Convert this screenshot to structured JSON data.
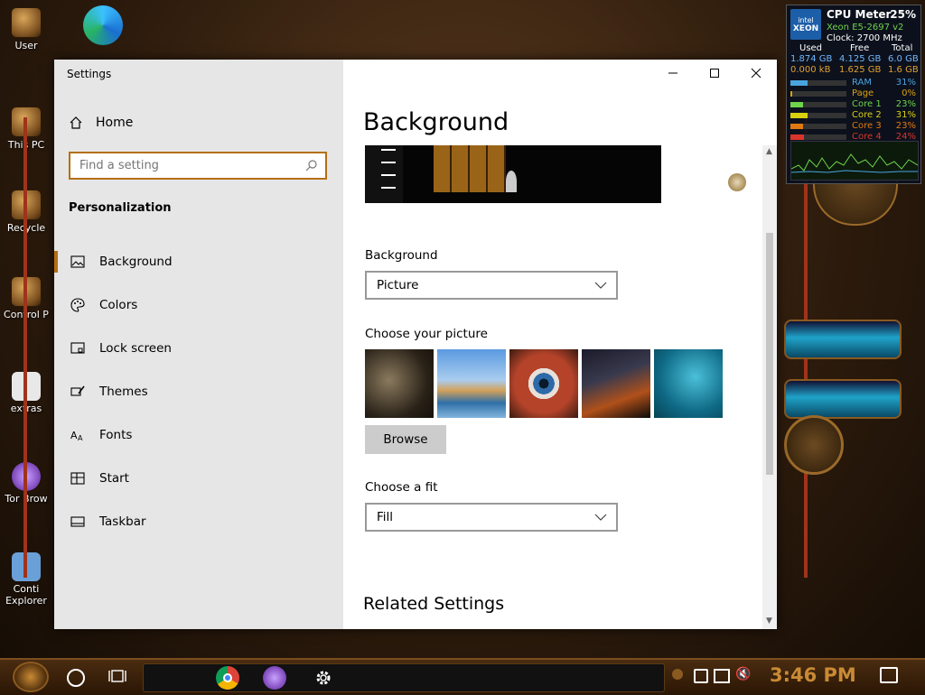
{
  "desktop": {
    "icons": [
      {
        "label": "User"
      },
      {
        "label": "This PC"
      },
      {
        "label": "Recycle"
      },
      {
        "label": "Control P"
      },
      {
        "label": "extras"
      },
      {
        "label": "Tor Brow"
      },
      {
        "label": "Conti Explorer"
      }
    ]
  },
  "window": {
    "title": "Settings",
    "controls": {
      "minimize": "minimize-icon",
      "maximize": "maximize-icon",
      "close": "close-icon"
    }
  },
  "nav": {
    "home_label": "Home",
    "search_placeholder": "Find a setting",
    "section": "Personalization",
    "items": [
      {
        "label": "Background",
        "icon": "image-icon"
      },
      {
        "label": "Colors",
        "icon": "palette-icon"
      },
      {
        "label": "Lock screen",
        "icon": "lock-screen-icon"
      },
      {
        "label": "Themes",
        "icon": "brush-icon"
      },
      {
        "label": "Fonts",
        "icon": "font-icon"
      },
      {
        "label": "Start",
        "icon": "start-icon"
      },
      {
        "label": "Taskbar",
        "icon": "taskbar-icon"
      }
    ],
    "active_index": 0
  },
  "content": {
    "page_title": "Background",
    "background_label": "Background",
    "background_value": "Picture",
    "choose_picture_label": "Choose your picture",
    "browse_label": "Browse",
    "fit_label": "Choose a fit",
    "fit_value": "Fill",
    "related_title": "Related Settings"
  },
  "cpu_meter": {
    "title": "CPU Meter",
    "percent": "25%",
    "cpu_name": "Xeon E5-2697 v2",
    "clock": "Clock: 2700 MHz",
    "headers": [
      "Used",
      "Free",
      "Total"
    ],
    "mem_rows": [
      [
        "1.874 GB",
        "4.125 GB",
        "6.0 GB"
      ],
      [
        "0.000 kB",
        "1.625 GB",
        "1.6 GB"
      ]
    ],
    "meters": [
      {
        "name": "RAM",
        "value": "31%",
        "fraction": 0.31,
        "color": "#4aa3df"
      },
      {
        "name": "Page",
        "value": "0%",
        "fraction": 0.0,
        "color": "#d9a010"
      },
      {
        "name": "Core 1",
        "value": "23%",
        "fraction": 0.23,
        "color": "#6fd34b"
      },
      {
        "name": "Core 2",
        "value": "31%",
        "fraction": 0.31,
        "color": "#d9d010"
      },
      {
        "name": "Core 3",
        "value": "23%",
        "fraction": 0.23,
        "color": "#e07a10"
      },
      {
        "name": "Core 4",
        "value": "24%",
        "fraction": 0.24,
        "color": "#d9352b"
      }
    ]
  },
  "taskbar": {
    "time": "3:46 PM"
  },
  "colors": {
    "accent": "#b46f13"
  }
}
